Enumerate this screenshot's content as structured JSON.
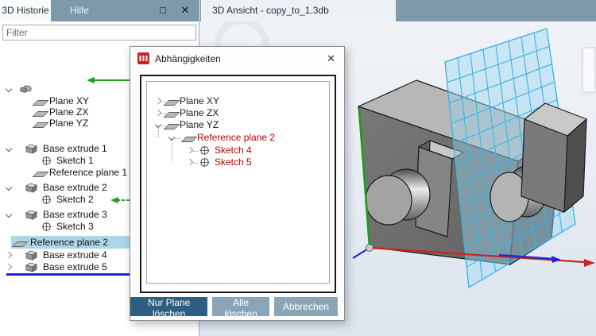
{
  "left_panel": {
    "tabs": [
      {
        "label": "3D Historie",
        "active": true
      },
      {
        "label": "Hilfe",
        "active": false
      }
    ],
    "window_controls": {
      "maximize_glyph": "□",
      "close_glyph": "✕"
    },
    "filter": {
      "placeholder": "Filter"
    },
    "tree": {
      "items": [
        {
          "label": "",
          "icon": "part",
          "state": "expanded"
        },
        {
          "label": "Plane XY",
          "icon": "plane"
        },
        {
          "label": "Plane ZX",
          "icon": "plane"
        },
        {
          "label": "Plane YZ",
          "icon": "plane",
          "marker": "green-arrow"
        },
        {
          "label": "Base extrude 1",
          "icon": "extrude",
          "state": "expanded"
        },
        {
          "label": "Sketch 1",
          "icon": "sketch"
        },
        {
          "label": "Reference plane 1",
          "icon": "plane"
        },
        {
          "label": "Base extrude 2",
          "icon": "extrude",
          "state": "expanded"
        },
        {
          "label": "Sketch 2",
          "icon": "sketch"
        },
        {
          "label": "Base extrude 3",
          "icon": "extrude",
          "state": "expanded"
        },
        {
          "label": "Sketch 3",
          "icon": "sketch"
        },
        {
          "label": "Reference plane 2",
          "icon": "plane",
          "selected": true,
          "marker": "green-arrow"
        },
        {
          "label": "Base extrude 4",
          "icon": "extrude",
          "state": "collapsed"
        },
        {
          "label": "Base extrude 5",
          "icon": "extrude",
          "state": "collapsed"
        }
      ]
    }
  },
  "dialog": {
    "title": "Abhängigkeiten",
    "close_glyph": "✕",
    "tree": [
      {
        "label": "Plane XY",
        "state": "collapsed",
        "color": "normal"
      },
      {
        "label": "Plane ZX",
        "state": "collapsed",
        "color": "normal"
      },
      {
        "label": "Plane YZ",
        "state": "expanded",
        "color": "normal"
      },
      {
        "label": "Reference plane 2",
        "state": "expanded",
        "color": "red"
      },
      {
        "label": "Sketch 4",
        "state": "collapsed",
        "color": "red"
      },
      {
        "label": "Sketch 5",
        "state": "collapsed",
        "color": "red"
      }
    ],
    "buttons": [
      {
        "label": "Nur Plane löschen",
        "variant": "primary"
      },
      {
        "label": "Alle löschen",
        "variant": "secondary"
      },
      {
        "label": "Abbrechen",
        "variant": "secondary"
      }
    ]
  },
  "viewport": {
    "tab_label": "3D Ansicht - copy_to_1.3db"
  },
  "colors": {
    "tabbar_bg": "#7e99a9",
    "selection_bg": "#a9d6e8",
    "insertion_line_blue": "#2121cc",
    "link_arrow_green": "#1ea01e",
    "dependency_red": "#c00000",
    "button_primary": "#2e5e80",
    "button_secondary": "#8aa5b8",
    "grid_cyan": "#36b5e8",
    "axis_red": "#cc2222",
    "axis_green": "#16a016",
    "axis_blue": "#2424cc"
  }
}
